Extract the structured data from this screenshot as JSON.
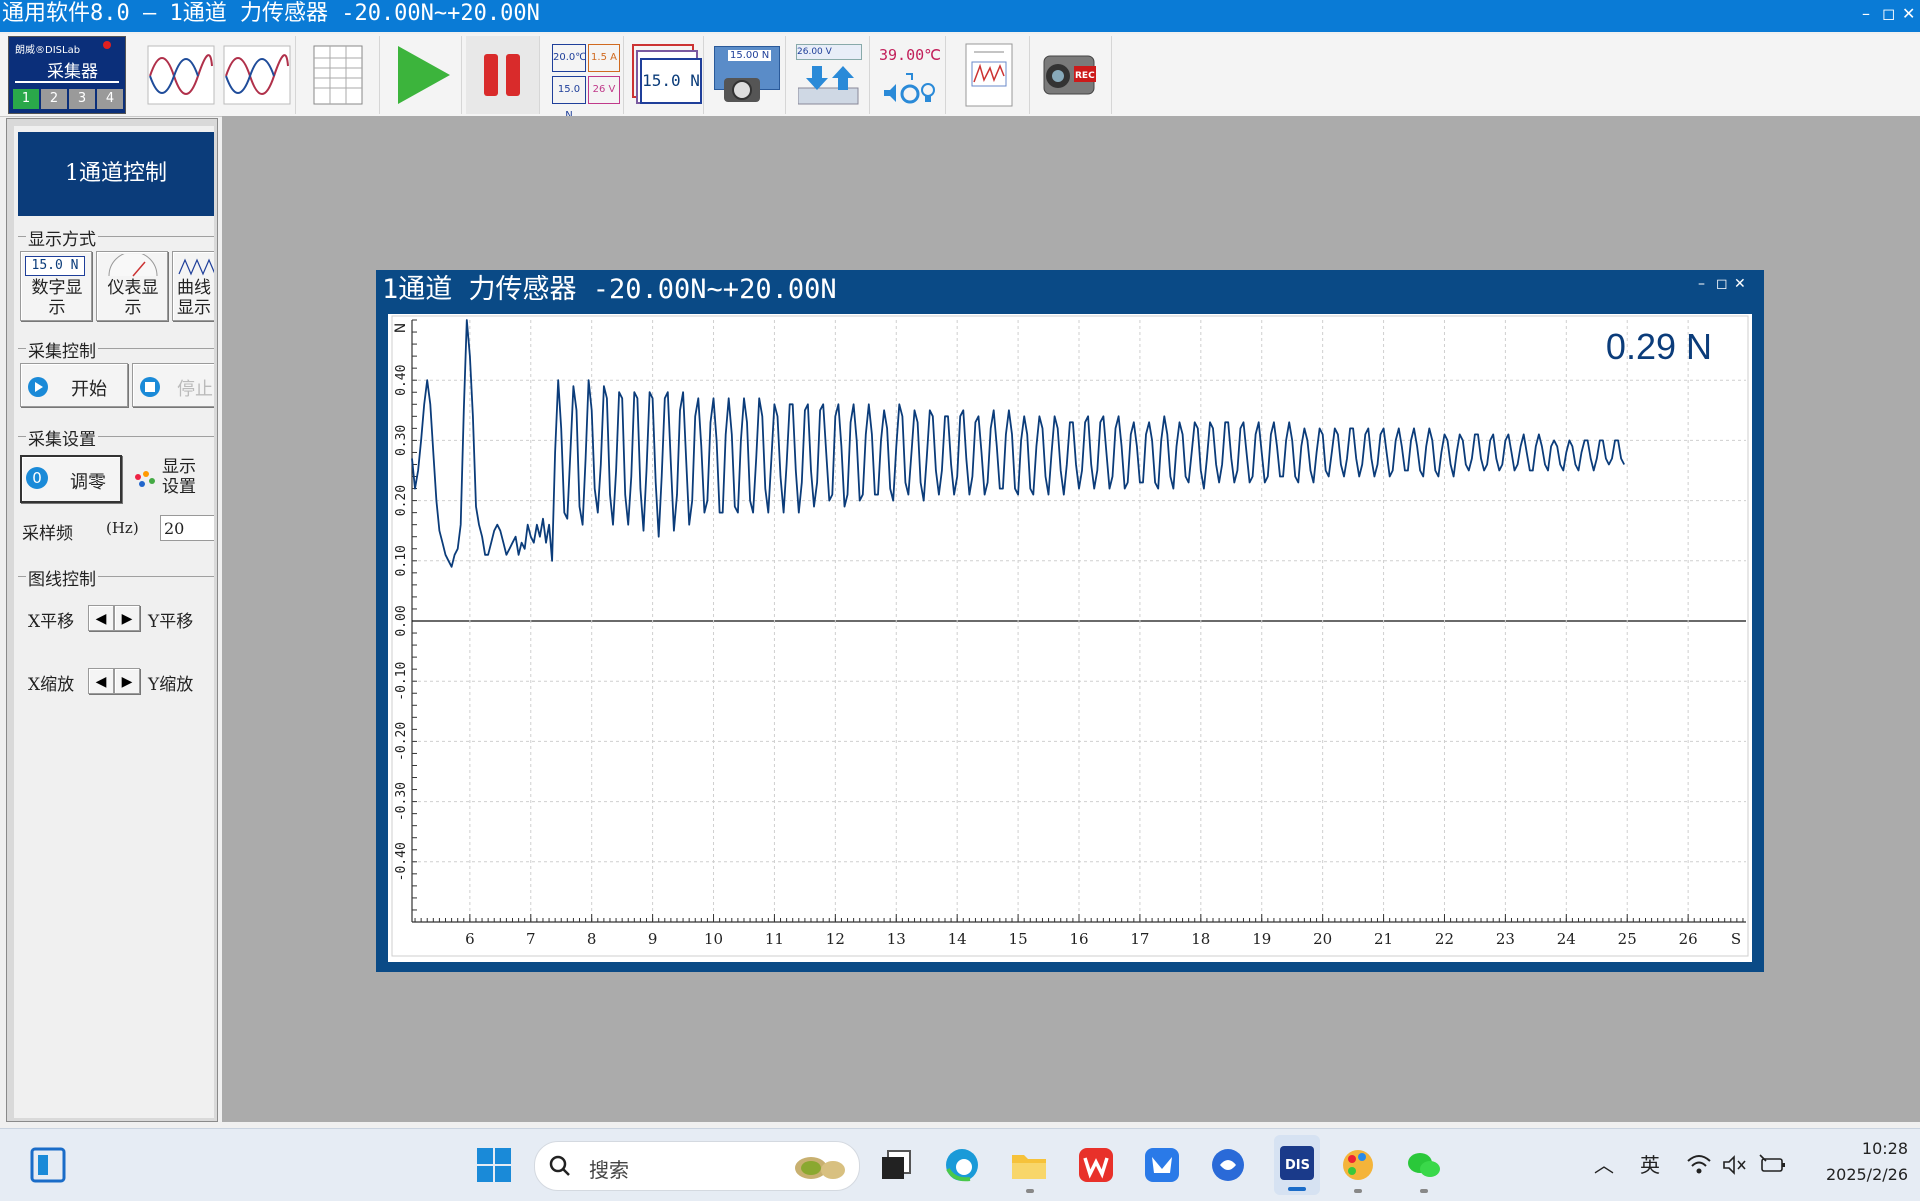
{
  "app": {
    "title": "通用软件8.0 – 1通道 力传感器 -20.00N~+20.00N",
    "win_min": "–",
    "win_max": "◻",
    "win_close": "✕"
  },
  "toolbar": {
    "collector_brand": "朗威®DISLab",
    "collector_label": "采集器",
    "channels": [
      "1",
      "2",
      "3",
      "4"
    ],
    "multi_display": [
      "20.0℃",
      "1.5 A",
      "15.0 N",
      "26 V"
    ],
    "digital_value": "15.0 N",
    "camera_value": "15.00 N",
    "transfer_value": "26.00 V",
    "temp_value": "39.00℃",
    "rec_label": "REC"
  },
  "sidebar": {
    "header": "1通道控制",
    "display_mode": {
      "label": "显示方式",
      "digital_value": "15.0 N",
      "digital_label": "数字显示",
      "meter_label": "仪表显示",
      "curve_label": "曲线显示"
    },
    "collect_control": {
      "label": "采集控制",
      "start": "开始",
      "stop": "停止"
    },
    "collect_settings": {
      "label": "采集设置",
      "zero_icon_text": "0",
      "zero": "调零",
      "display_settings": "显示设置",
      "rate_label": "采样频",
      "rate_unit": "(Hz)",
      "rate_value": "20"
    },
    "graph_control": {
      "label": "图线控制",
      "x_shift": "X平移",
      "y_shift": "Y平移",
      "x_zoom": "X缩放",
      "y_zoom": "Y缩放"
    }
  },
  "chart_window": {
    "title": "1通道  力传感器 -20.00N~+20.00N",
    "min": "–",
    "max": "◻",
    "close": "✕",
    "readout": "0.29 N"
  },
  "chart_data": {
    "type": "line",
    "ylabel": "N",
    "xlabel": "S",
    "xlim": [
      5.05,
      26.95
    ],
    "ylim": [
      -0.5,
      0.5
    ],
    "x_ticks": [
      6,
      7,
      8,
      9,
      10,
      11,
      12,
      13,
      14,
      15,
      16,
      17,
      18,
      19,
      20,
      21,
      22,
      23,
      24,
      25,
      26
    ],
    "y_ticks": [
      0.4,
      0.3,
      0.2,
      0.1,
      0.0,
      -0.1,
      -0.2,
      -0.3,
      -0.4
    ],
    "y_tick_labels": [
      "0.40",
      "0.30",
      "0.20",
      "0.10",
      "0.00",
      "-0.10",
      "-0.20",
      "-0.30",
      "-0.40"
    ],
    "grid": true,
    "sample_rate_hz": 20,
    "color": "#0b3c7a",
    "x": [
      5.05,
      5.1,
      5.15,
      5.2,
      5.25,
      5.3,
      5.35,
      5.4,
      5.45,
      5.5,
      5.55,
      5.6,
      5.65,
      5.7,
      5.75,
      5.8,
      5.85,
      5.9,
      5.95,
      6.0,
      6.05,
      6.1,
      6.15,
      6.2,
      6.25,
      6.3,
      6.35,
      6.4,
      6.45,
      6.5,
      6.55,
      6.6,
      6.65,
      6.7,
      6.75,
      6.8,
      6.85,
      6.9,
      6.95,
      7.0,
      7.05,
      7.1,
      7.15,
      7.2,
      7.25,
      7.3,
      7.35,
      7.4,
      7.45,
      7.5,
      7.55,
      7.6,
      7.65,
      7.7,
      7.75,
      7.8,
      7.85,
      7.9,
      7.95,
      8.0,
      8.05,
      8.1,
      8.15,
      8.2,
      8.25,
      8.3,
      8.35,
      8.4,
      8.45,
      8.5,
      8.55,
      8.6,
      8.65,
      8.7,
      8.75,
      8.8,
      8.85,
      8.9,
      8.95,
      9.0,
      9.05,
      9.1,
      9.15,
      9.2,
      9.25,
      9.3,
      9.35,
      9.4,
      9.45,
      9.5,
      9.55,
      9.6,
      9.65,
      9.7,
      9.75,
      9.8,
      9.85,
      9.9,
      9.95,
      10.0,
      10.05,
      10.1,
      10.15,
      10.2,
      10.25,
      10.3,
      10.35,
      10.4,
      10.45,
      10.5,
      10.55,
      10.6,
      10.65,
      10.7,
      10.75,
      10.8,
      10.85,
      10.9,
      10.95,
      11.0,
      11.05,
      11.1,
      11.15,
      11.2,
      11.25,
      11.3,
      11.35,
      11.4,
      11.45,
      11.5,
      11.55,
      11.6,
      11.65,
      11.7,
      11.75,
      11.8,
      11.85,
      11.9,
      11.95,
      12.0,
      12.05,
      12.1,
      12.15,
      12.2,
      12.25,
      12.3,
      12.35,
      12.4,
      12.45,
      12.5,
      12.55,
      12.6,
      12.65,
      12.7,
      12.75,
      12.8,
      12.85,
      12.9,
      12.95,
      13.0,
      13.05,
      13.1,
      13.15,
      13.2,
      13.25,
      13.3,
      13.35,
      13.4,
      13.45,
      13.5,
      13.55,
      13.6,
      13.65,
      13.7,
      13.75,
      13.8,
      13.85,
      13.9,
      13.95,
      14.0,
      14.05,
      14.1,
      14.15,
      14.2,
      14.25,
      14.3,
      14.35,
      14.4,
      14.45,
      14.5,
      14.55,
      14.6,
      14.65,
      14.7,
      14.75,
      14.8,
      14.85,
      14.9,
      14.95,
      15.0,
      15.05,
      15.1,
      15.15,
      15.2,
      15.25,
      15.3,
      15.35,
      15.4,
      15.45,
      15.5,
      15.55,
      15.6,
      15.65,
      15.7,
      15.75,
      15.8,
      15.85,
      15.9,
      15.95,
      16.0,
      16.05,
      16.1,
      16.15,
      16.2,
      16.25,
      16.3,
      16.35,
      16.4,
      16.45,
      16.5,
      16.55,
      16.6,
      16.65,
      16.7,
      16.75,
      16.8,
      16.85,
      16.9,
      16.95,
      17.0,
      17.05,
      17.1,
      17.15,
      17.2,
      17.25,
      17.3,
      17.35,
      17.4,
      17.45,
      17.5,
      17.55,
      17.6,
      17.65,
      17.7,
      17.75,
      17.8,
      17.85,
      17.9,
      17.95,
      18.0,
      18.05,
      18.1,
      18.15,
      18.2,
      18.25,
      18.3,
      18.35,
      18.4,
      18.45,
      18.5,
      18.55,
      18.6,
      18.65,
      18.7,
      18.75,
      18.8,
      18.85,
      18.9,
      18.95,
      19.0,
      19.05,
      19.1,
      19.15,
      19.2,
      19.25,
      19.3,
      19.35,
      19.4,
      19.45,
      19.5,
      19.55,
      19.6,
      19.65,
      19.7,
      19.75,
      19.8,
      19.85,
      19.9,
      19.95,
      20.0,
      20.05,
      20.1,
      20.15,
      20.2,
      20.25,
      20.3,
      20.35,
      20.4,
      20.45,
      20.5,
      20.55,
      20.6,
      20.65,
      20.7,
      20.75,
      20.8,
      20.85,
      20.9,
      20.95,
      21.0,
      21.05,
      21.1,
      21.15,
      21.2,
      21.25,
      21.3,
      21.35,
      21.4,
      21.45,
      21.5,
      21.55,
      21.6,
      21.65,
      21.7,
      21.75,
      21.8,
      21.85,
      21.9,
      21.95,
      22.0,
      22.05,
      22.1,
      22.15,
      22.2,
      22.25,
      22.3,
      22.35,
      22.4,
      22.45,
      22.5,
      22.55,
      22.6,
      22.65,
      22.7,
      22.75,
      22.8,
      22.85,
      22.9,
      22.95,
      23.0,
      23.05,
      23.1,
      23.15,
      23.2,
      23.25,
      23.3,
      23.35,
      23.4,
      23.45,
      23.5,
      23.55,
      23.6,
      23.65,
      23.7,
      23.75,
      23.8,
      23.85,
      23.9,
      23.95,
      24.0,
      24.05,
      24.1,
      24.15,
      24.2,
      24.25,
      24.3,
      24.35,
      24.4,
      24.45,
      24.5,
      24.55,
      24.6,
      24.65,
      24.7,
      24.75,
      24.8,
      24.85,
      24.9,
      24.95,
      25.0,
      25.05,
      25.1,
      25.15,
      25.2,
      25.25,
      25.3,
      25.35,
      25.4,
      25.45,
      25.5,
      25.55,
      25.6,
      25.65,
      25.7,
      25.75,
      25.8,
      25.85,
      25.9,
      25.95,
      26.0,
      26.05,
      26.1,
      26.15,
      26.2,
      26.25,
      26.3,
      26.35,
      26.4,
      26.45,
      26.5,
      26.55,
      26.6,
      26.65,
      26.7,
      26.75,
      26.8,
      26.85,
      26.9
    ],
    "y": [
      0.27,
      0.22,
      0.25,
      0.3,
      0.36,
      0.4,
      0.36,
      0.28,
      0.2,
      0.15,
      0.13,
      0.11,
      0.1,
      0.09,
      0.11,
      0.12,
      0.16,
      0.35,
      0.5,
      0.44,
      0.34,
      0.19,
      0.16,
      0.14,
      0.11,
      0.11,
      0.13,
      0.15,
      0.16,
      0.15,
      0.13,
      0.11,
      0.12,
      0.13,
      0.14,
      0.11,
      0.13,
      0.12,
      0.16,
      0.14,
      0.13,
      0.16,
      0.14,
      0.17,
      0.13,
      0.16,
      0.1,
      0.28,
      0.4,
      0.32,
      0.18,
      0.17,
      0.28,
      0.39,
      0.35,
      0.19,
      0.16,
      0.27,
      0.4,
      0.35,
      0.22,
      0.18,
      0.26,
      0.39,
      0.37,
      0.21,
      0.16,
      0.25,
      0.38,
      0.37,
      0.21,
      0.16,
      0.24,
      0.38,
      0.37,
      0.22,
      0.15,
      0.25,
      0.38,
      0.37,
      0.23,
      0.14,
      0.24,
      0.37,
      0.38,
      0.26,
      0.15,
      0.21,
      0.35,
      0.38,
      0.27,
      0.16,
      0.2,
      0.34,
      0.37,
      0.29,
      0.18,
      0.2,
      0.33,
      0.37,
      0.3,
      0.18,
      0.18,
      0.31,
      0.37,
      0.31,
      0.19,
      0.18,
      0.3,
      0.37,
      0.33,
      0.2,
      0.18,
      0.27,
      0.37,
      0.34,
      0.22,
      0.18,
      0.27,
      0.36,
      0.34,
      0.24,
      0.18,
      0.26,
      0.36,
      0.36,
      0.25,
      0.18,
      0.23,
      0.35,
      0.36,
      0.25,
      0.19,
      0.23,
      0.35,
      0.36,
      0.28,
      0.2,
      0.21,
      0.34,
      0.36,
      0.29,
      0.19,
      0.21,
      0.33,
      0.36,
      0.3,
      0.2,
      0.21,
      0.31,
      0.36,
      0.31,
      0.21,
      0.21,
      0.3,
      0.35,
      0.32,
      0.22,
      0.2,
      0.29,
      0.36,
      0.34,
      0.23,
      0.21,
      0.28,
      0.35,
      0.33,
      0.23,
      0.2,
      0.27,
      0.35,
      0.34,
      0.25,
      0.21,
      0.25,
      0.34,
      0.34,
      0.26,
      0.21,
      0.24,
      0.34,
      0.35,
      0.27,
      0.21,
      0.24,
      0.33,
      0.34,
      0.28,
      0.21,
      0.23,
      0.32,
      0.35,
      0.29,
      0.22,
      0.22,
      0.31,
      0.35,
      0.31,
      0.22,
      0.21,
      0.3,
      0.34,
      0.31,
      0.22,
      0.21,
      0.29,
      0.34,
      0.32,
      0.24,
      0.21,
      0.28,
      0.34,
      0.32,
      0.25,
      0.21,
      0.26,
      0.33,
      0.33,
      0.26,
      0.22,
      0.25,
      0.33,
      0.34,
      0.26,
      0.22,
      0.25,
      0.33,
      0.34,
      0.28,
      0.22,
      0.24,
      0.32,
      0.34,
      0.29,
      0.22,
      0.23,
      0.31,
      0.33,
      0.29,
      0.23,
      0.23,
      0.31,
      0.33,
      0.3,
      0.23,
      0.22,
      0.3,
      0.34,
      0.31,
      0.24,
      0.22,
      0.29,
      0.33,
      0.31,
      0.24,
      0.23,
      0.28,
      0.33,
      0.32,
      0.25,
      0.22,
      0.27,
      0.33,
      0.32,
      0.26,
      0.23,
      0.26,
      0.33,
      0.33,
      0.27,
      0.23,
      0.25,
      0.32,
      0.33,
      0.28,
      0.23,
      0.24,
      0.31,
      0.33,
      0.28,
      0.23,
      0.24,
      0.31,
      0.33,
      0.29,
      0.24,
      0.24,
      0.3,
      0.33,
      0.3,
      0.24,
      0.23,
      0.29,
      0.32,
      0.3,
      0.25,
      0.23,
      0.28,
      0.32,
      0.31,
      0.25,
      0.24,
      0.28,
      0.32,
      0.31,
      0.26,
      0.24,
      0.27,
      0.32,
      0.32,
      0.27,
      0.24,
      0.26,
      0.31,
      0.32,
      0.27,
      0.24,
      0.26,
      0.31,
      0.32,
      0.28,
      0.24,
      0.25,
      0.3,
      0.32,
      0.29,
      0.25,
      0.25,
      0.3,
      0.32,
      0.29,
      0.25,
      0.24,
      0.29,
      0.32,
      0.3,
      0.25,
      0.24,
      0.28,
      0.31,
      0.3,
      0.26,
      0.24,
      0.28,
      0.31,
      0.3,
      0.26,
      0.25,
      0.27,
      0.31,
      0.31,
      0.27,
      0.25,
      0.26,
      0.3,
      0.31,
      0.27,
      0.25,
      0.26,
      0.3,
      0.31,
      0.28,
      0.25,
      0.26,
      0.29,
      0.31,
      0.28,
      0.25,
      0.25,
      0.29,
      0.31,
      0.29,
      0.26,
      0.25,
      0.29,
      0.3,
      0.29,
      0.26,
      0.25,
      0.28,
      0.3,
      0.29,
      0.26,
      0.25,
      0.28,
      0.3,
      0.3,
      0.27,
      0.25,
      0.27,
      0.3,
      0.3,
      0.27,
      0.26,
      0.27,
      0.3,
      0.3,
      0.27,
      0.26
    ]
  },
  "taskbar": {
    "search_placeholder": "搜索",
    "ime": "英",
    "time": "10:28",
    "date": "2025/2/26"
  }
}
